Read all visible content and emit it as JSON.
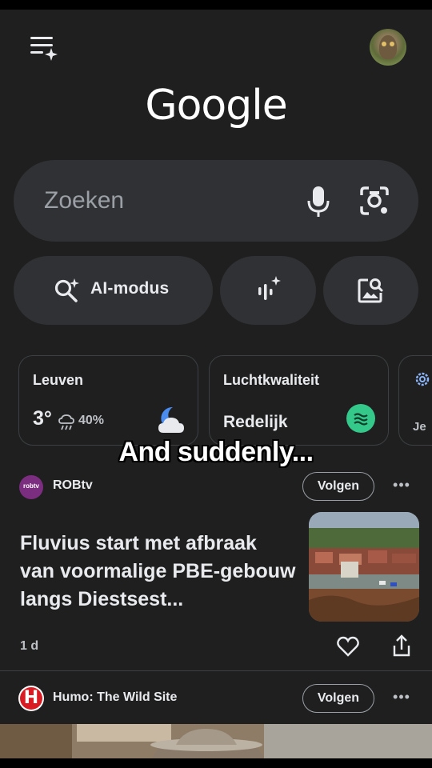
{
  "header": {
    "logo": "Google"
  },
  "search": {
    "placeholder": "Zoeken"
  },
  "chips": {
    "ai_mode_label": "AI-modus"
  },
  "cards": {
    "weather": {
      "city": "Leuven",
      "temperature": "3°",
      "rain_chance": "40%"
    },
    "air": {
      "title": "Luchtkwaliteit",
      "status": "Redelijk",
      "status_color": "#34c98a"
    },
    "third": {
      "text": "Je"
    }
  },
  "caption": "And suddenly...",
  "feed": [
    {
      "source": "ROBtv",
      "source_logo_text": "robtv",
      "follow_label": "Volgen",
      "headline": "Fluvius start met afbraak van voormalige PBE-gebouw langs Diestsest...",
      "age": "1 d"
    },
    {
      "source": "Humo: The Wild Site",
      "source_logo_text": "H",
      "follow_label": "Volgen"
    }
  ],
  "icons": {
    "menu": "menu-sparkle-icon",
    "mic": "mic-icon",
    "lens": "camera-lens-icon",
    "ai": "search-sparkle-icon",
    "voice": "voice-sparkle-icon",
    "image_search": "image-search-icon",
    "weather": "moon-cloud-icon",
    "air": "air-quality-icon",
    "like": "heart-icon",
    "share": "share-icon",
    "more": "more-icon"
  }
}
